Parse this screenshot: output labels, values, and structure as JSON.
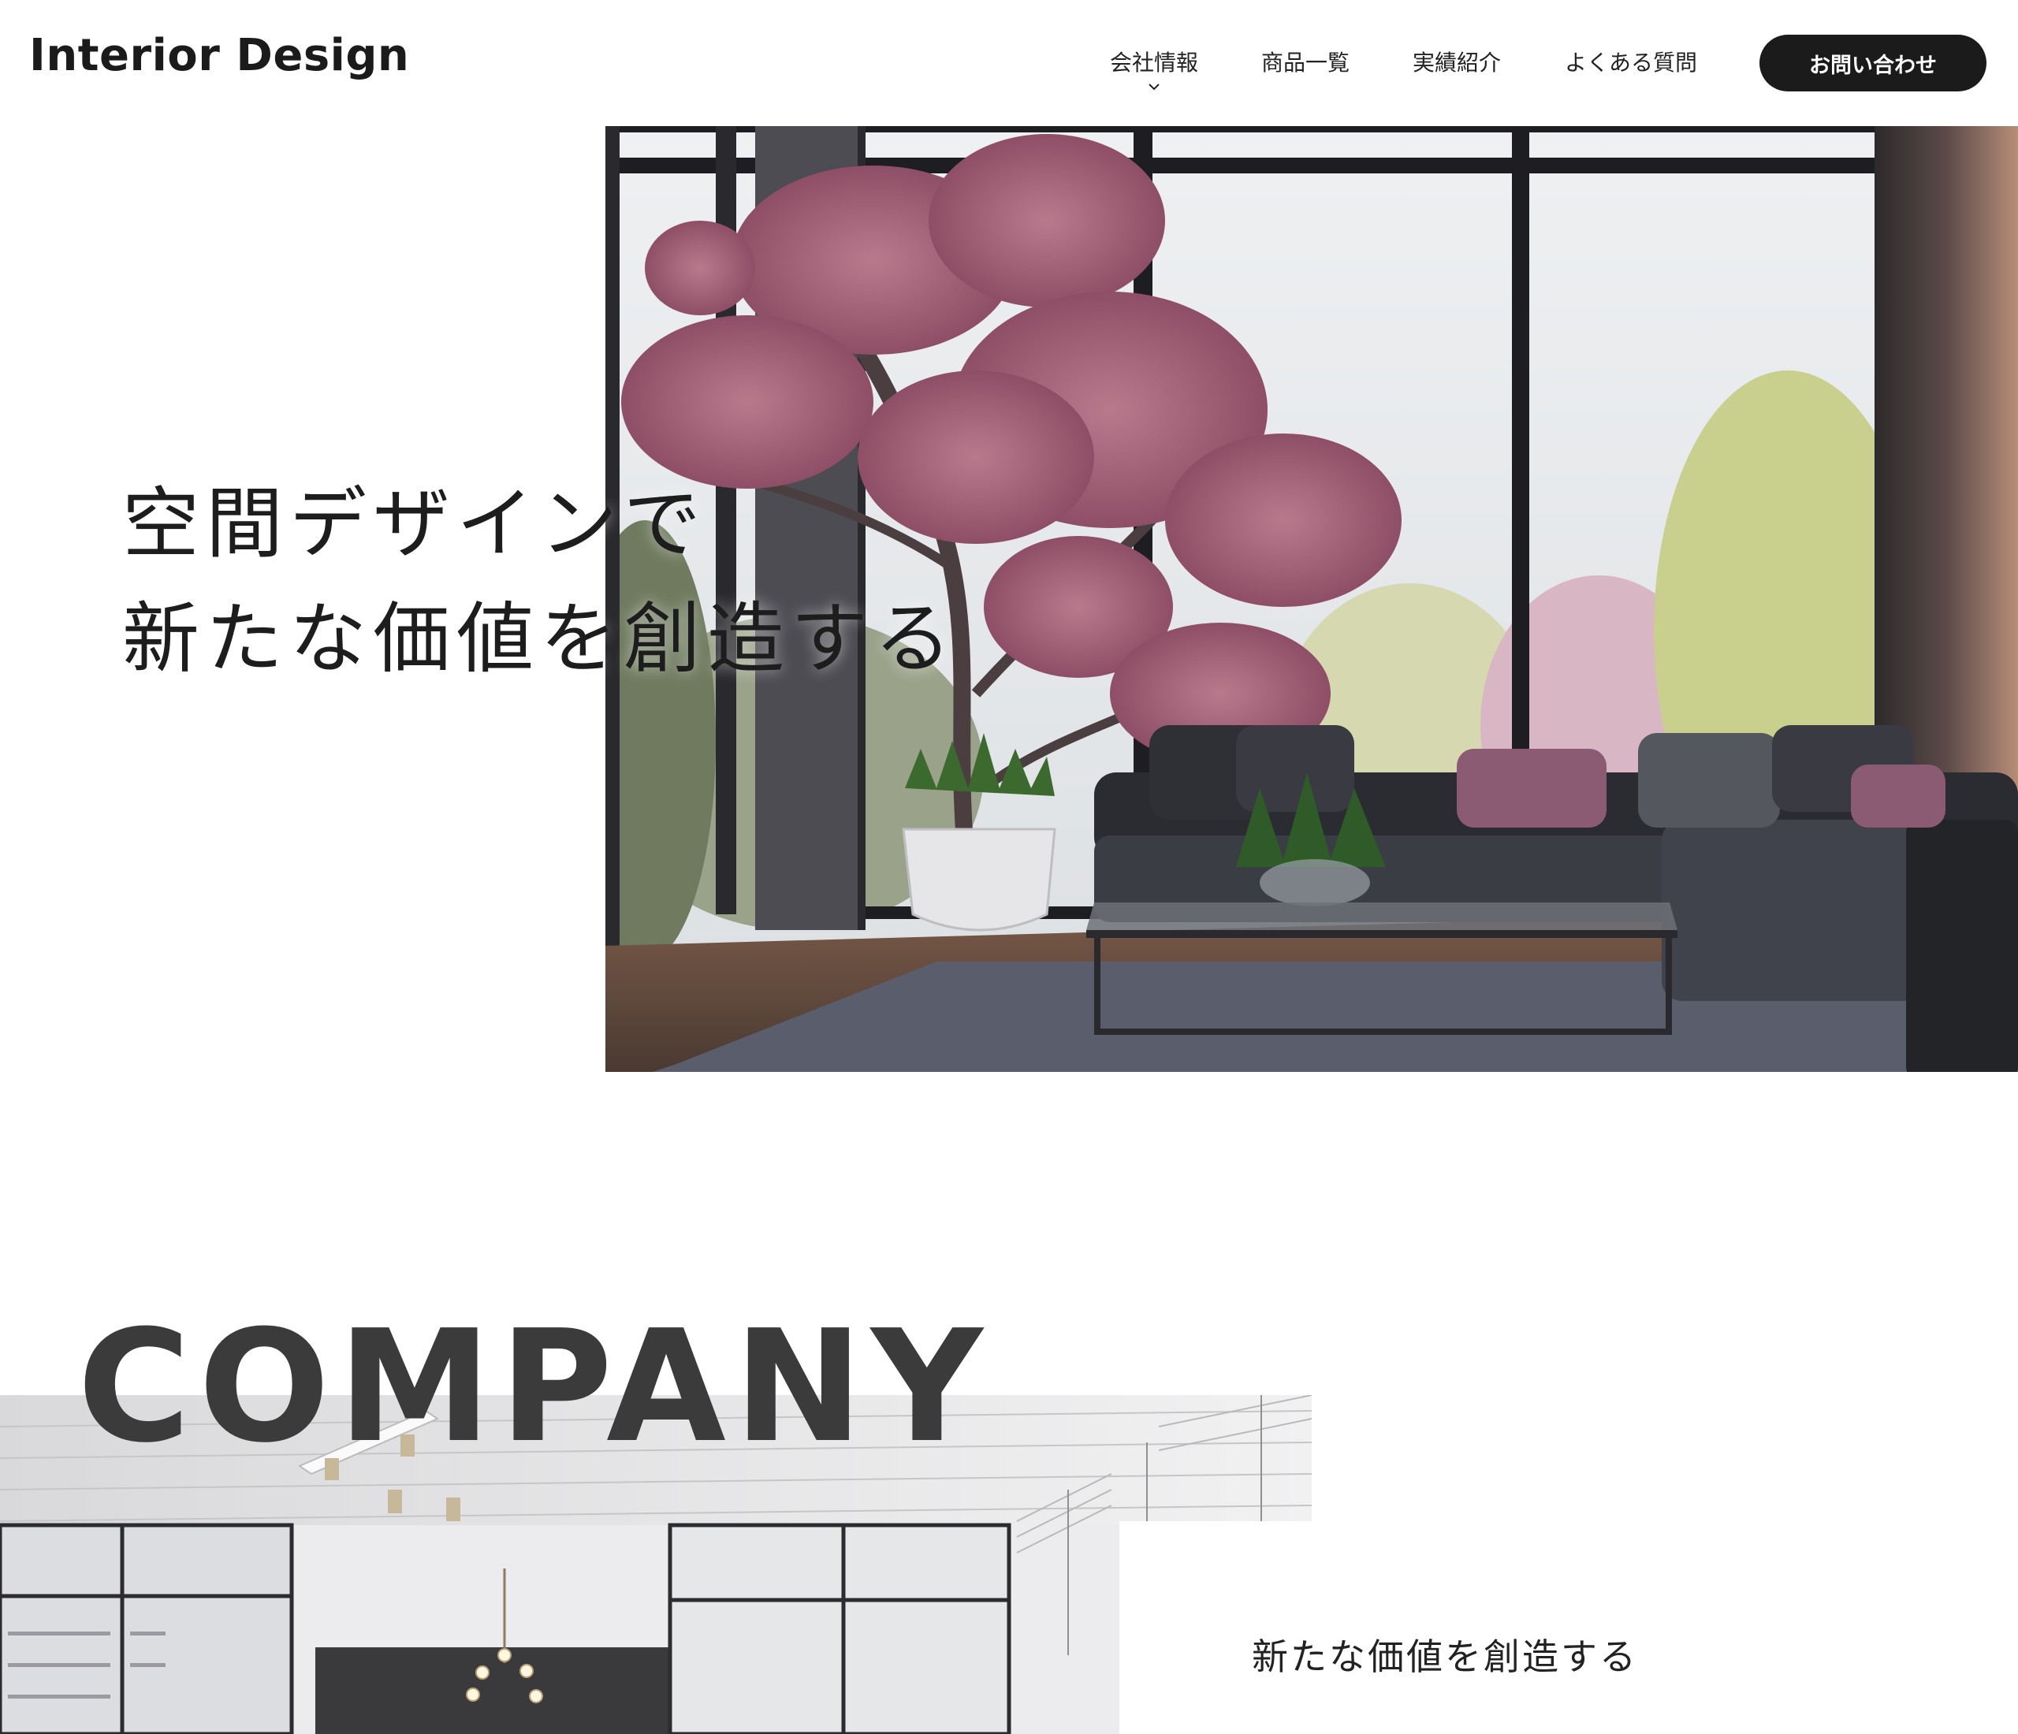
{
  "header": {
    "logo": "Interior Design",
    "nav": [
      {
        "label": "会社情報",
        "has_dropdown": true
      },
      {
        "label": "商品一覧",
        "has_dropdown": false
      },
      {
        "label": "実績紹介",
        "has_dropdown": false
      },
      {
        "label": "よくある質問",
        "has_dropdown": false
      }
    ],
    "cta_label": "お問い合わせ"
  },
  "hero": {
    "line1": "空間デザインで",
    "line2": "新たな価値を創造する"
  },
  "company": {
    "heading": "COMPANY",
    "subheading": "新たな価値を創造する"
  },
  "colors": {
    "text": "#1b1b1b",
    "button_bg": "#1b1b1b",
    "button_text": "#ffffff",
    "heading_gray": "#3b3b3b"
  }
}
